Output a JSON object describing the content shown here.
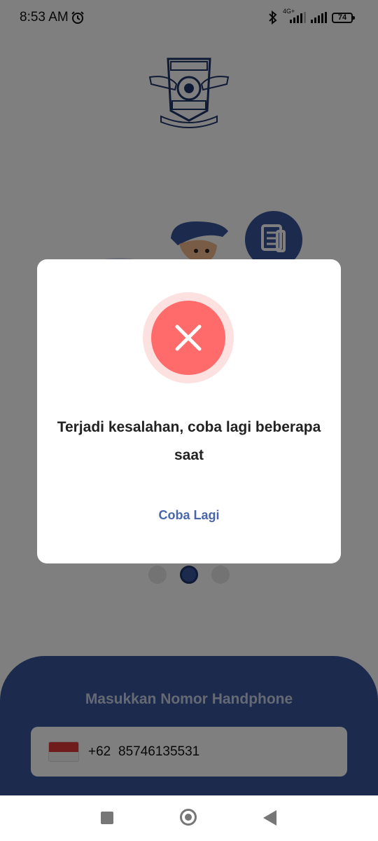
{
  "status_bar": {
    "time": "8:53 AM",
    "network": "4G+",
    "battery": "74",
    "icons": [
      "alarm-icon",
      "bluetooth-icon",
      "signal-icon",
      "signal-icon",
      "battery-icon"
    ]
  },
  "pager": {
    "count": 3,
    "active_index": 1
  },
  "login": {
    "title": "Masukkan Nomor Handphone",
    "country_code": "+62",
    "phone_number": "85746135531",
    "flag_icon": "indonesia-flag-icon"
  },
  "dialog": {
    "icon": "error-x-icon",
    "message": "Terjadi kesalahan, coba lagi beberapa saat",
    "retry_label": "Coba Lagi"
  },
  "colors": {
    "primary": "#36549a",
    "error": "#ff6a6a",
    "error_ring": "#fde0e0",
    "link": "#4a66a8"
  },
  "nav": {
    "icons": [
      "recents-icon",
      "home-icon",
      "back-icon"
    ]
  }
}
